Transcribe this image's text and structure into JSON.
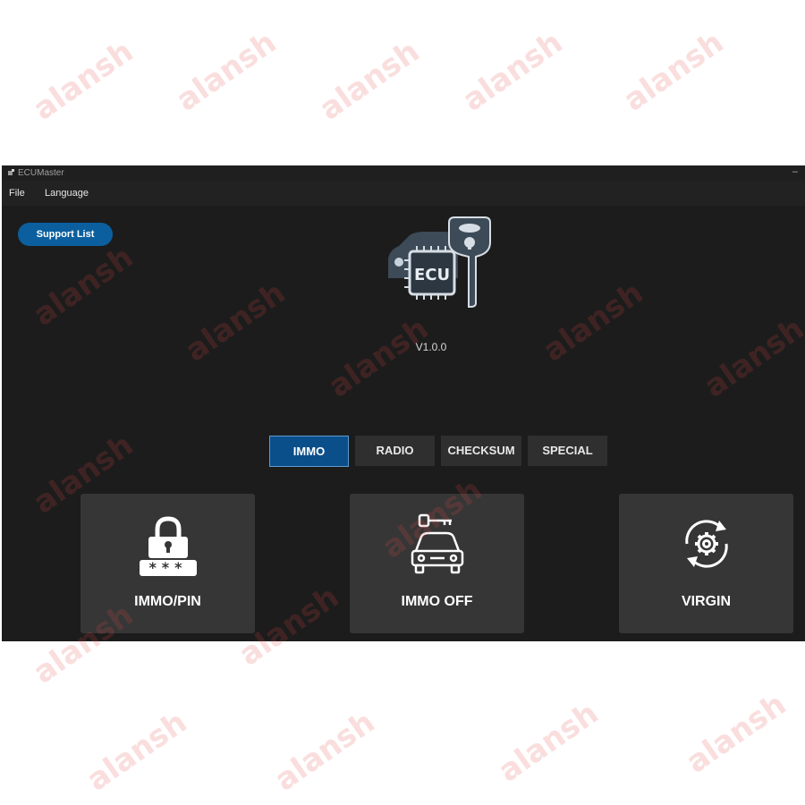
{
  "window": {
    "title": "ECUMaster",
    "minimize_glyph": "–"
  },
  "menu": {
    "file": "File",
    "language": "Language"
  },
  "support_button": "Support List",
  "logo": {
    "badge_text": "ECU",
    "icon": "ecu-car-key-logo"
  },
  "version": "V1.0.0",
  "tabs": [
    {
      "label": "IMMO",
      "active": true
    },
    {
      "label": "RADIO",
      "active": false
    },
    {
      "label": "CHECKSUM",
      "active": false
    },
    {
      "label": "SPECIAL",
      "active": false
    }
  ],
  "cards": [
    {
      "label": "IMMO/PIN",
      "icon": "lock-pin-icon"
    },
    {
      "label": "IMMO OFF",
      "icon": "car-key-icon"
    },
    {
      "label": "VIRGIN",
      "icon": "gear-refresh-icon"
    }
  ],
  "watermark_text": "alansh",
  "colors": {
    "window_bg": "#1c1c1c",
    "accent_blue": "#0b5f9e",
    "active_tab": "#0b4f8a",
    "card_bg": "#363636",
    "watermark": "#e64646"
  }
}
